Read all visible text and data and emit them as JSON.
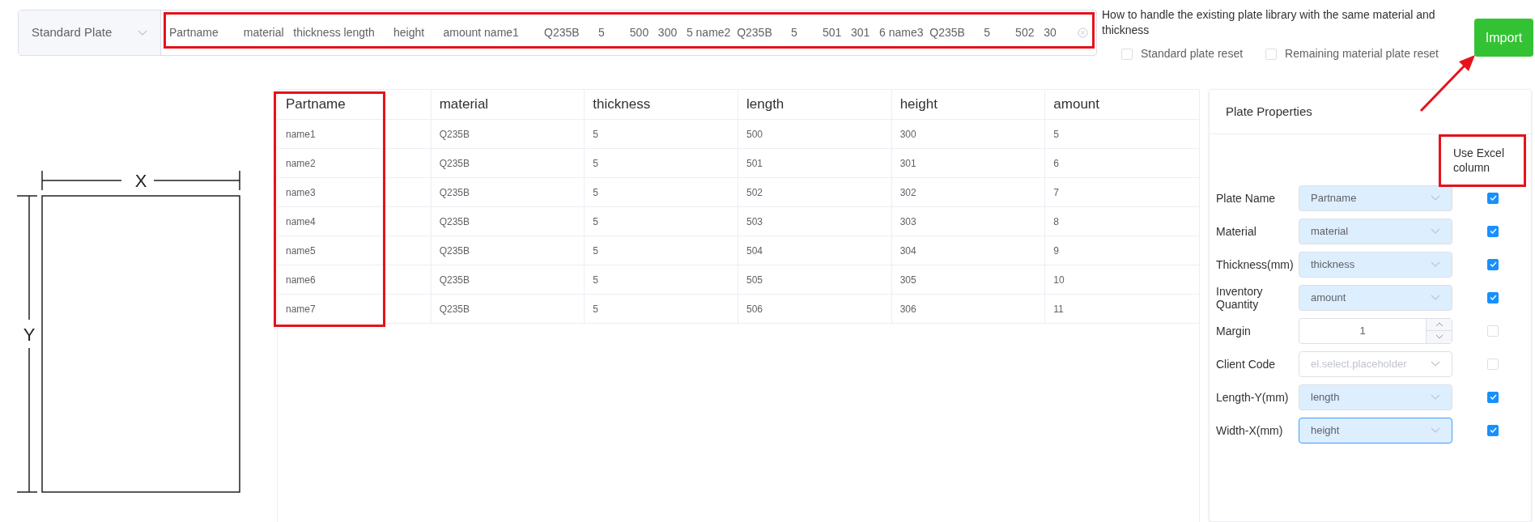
{
  "source_select": {
    "value": "Standard Plate"
  },
  "paste_field": {
    "value": "Partname        material   thickness length      height      amount name1        Q235B      5        500   300   5 name2  Q235B      5        501   301   6 name3  Q235B      5        502   30"
  },
  "existing_handling": {
    "question": "How to handle the existing plate library with the same material and thickness",
    "options": [
      {
        "label": "Standard plate reset",
        "checked": false
      },
      {
        "label": "Remaining material plate reset",
        "checked": false
      }
    ]
  },
  "import_button": "Import",
  "diagram": {
    "x_label": "X",
    "y_label": "Y"
  },
  "table": {
    "columns": [
      "Partname",
      "material",
      "thickness",
      "length",
      "height",
      "amount"
    ],
    "rows": [
      [
        "name1",
        "Q235B",
        "5",
        "500",
        "300",
        "5"
      ],
      [
        "name2",
        "Q235B",
        "5",
        "501",
        "301",
        "6"
      ],
      [
        "name3",
        "Q235B",
        "5",
        "502",
        "302",
        "7"
      ],
      [
        "name4",
        "Q235B",
        "5",
        "503",
        "303",
        "8"
      ],
      [
        "name5",
        "Q235B",
        "5",
        "504",
        "304",
        "9"
      ],
      [
        "name6",
        "Q235B",
        "5",
        "505",
        "305",
        "10"
      ],
      [
        "name7",
        "Q235B",
        "5",
        "506",
        "306",
        "11"
      ]
    ]
  },
  "properties": {
    "title": "Plate Properties",
    "use_excel_heading": "Use Excel column",
    "fields": [
      {
        "label": "Plate Name",
        "kind": "select",
        "value": "Partname",
        "checked": true,
        "focused": false
      },
      {
        "label": "Material",
        "kind": "select",
        "value": "material",
        "checked": true,
        "focused": false
      },
      {
        "label": "Thickness(mm)",
        "kind": "select",
        "value": "thickness",
        "checked": true,
        "focused": false
      },
      {
        "label": "Inventory Quantity",
        "kind": "select",
        "value": "amount",
        "checked": true,
        "focused": false
      },
      {
        "label": "Margin",
        "kind": "number",
        "value": "1",
        "checked": false,
        "focused": false
      },
      {
        "label": "Client Code",
        "kind": "select",
        "placeholder": "el.select.placeholder",
        "checked": false,
        "focused": false
      },
      {
        "label": "Length-Y(mm)",
        "kind": "select",
        "value": "length",
        "checked": true,
        "focused": false
      },
      {
        "label": "Width-X(mm)",
        "kind": "select",
        "value": "height",
        "checked": true,
        "focused": true
      }
    ]
  }
}
